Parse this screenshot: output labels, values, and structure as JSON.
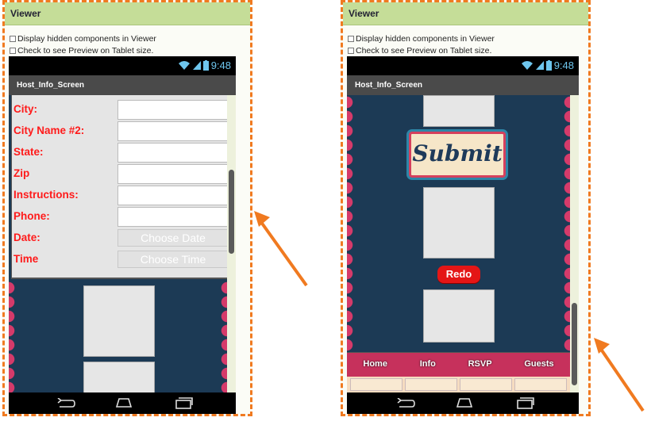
{
  "left_viewer": {
    "header": "Viewer",
    "option_hidden": "Display hidden components in Viewer",
    "option_tablet": "Check to see Preview on Tablet size.",
    "time": "9:48",
    "screen_title": "Host_Info_Screen",
    "fields": [
      {
        "label": "City:"
      },
      {
        "label": "City Name #2:"
      },
      {
        "label": "State:"
      },
      {
        "label": "Zip"
      },
      {
        "label": "Instructions:"
      },
      {
        "label": "Phone:"
      }
    ],
    "date_label": "Date:",
    "date_button": "Choose Date",
    "time_label": "Time",
    "time_button": "Choose Time"
  },
  "right_viewer": {
    "header": "Viewer",
    "option_hidden": "Display hidden components in Viewer",
    "option_tablet": "Check to see Preview on Tablet size.",
    "time": "9:48",
    "screen_title": "Host_Info_Screen",
    "submit_label": "Submit",
    "redo_label": "Redo",
    "tabs": [
      "Home",
      "Info",
      "RSVP",
      "Guests"
    ]
  },
  "colors": {
    "accent_dashed_border": "#f07a20",
    "viewer_header": "#c5dd98",
    "label_red": "#ff1a1a",
    "app_background": "#1c3a55",
    "arrow": "#f07a20"
  },
  "icons": [
    "wifi-icon",
    "signal-icon",
    "battery-icon",
    "back-icon",
    "home-icon",
    "recent-apps-icon",
    "annotation-arrow"
  ]
}
